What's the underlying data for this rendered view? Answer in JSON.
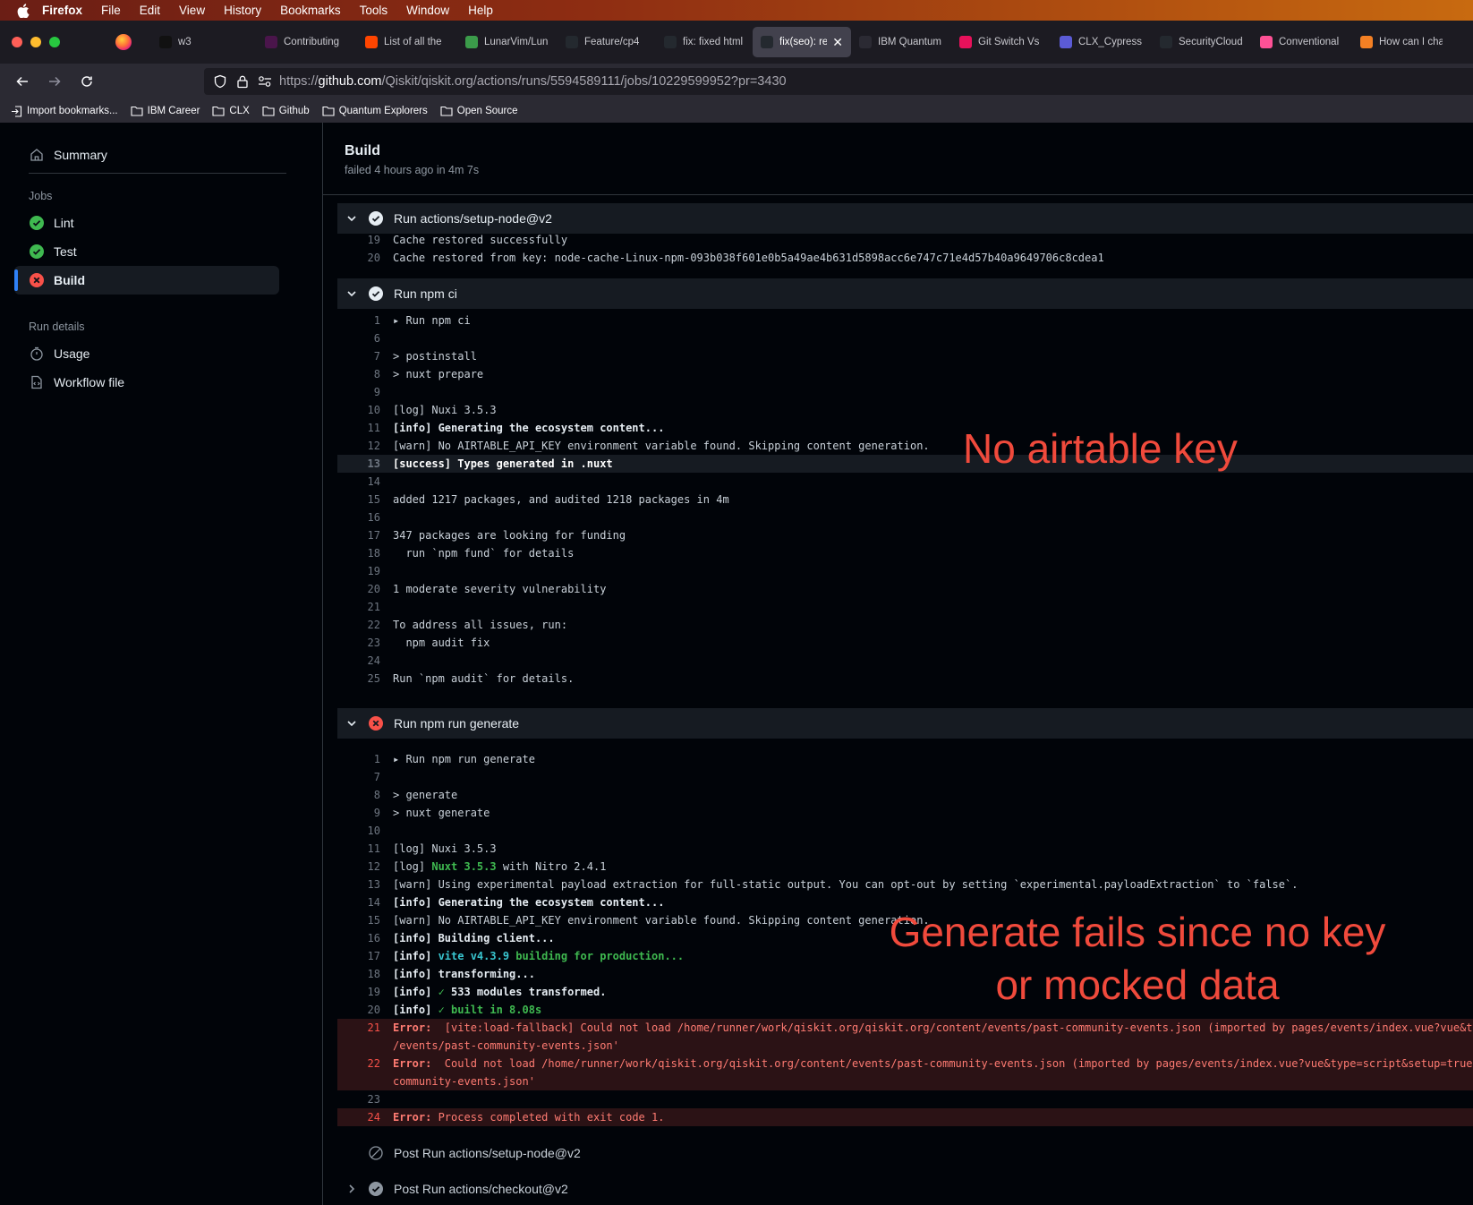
{
  "menubar": {
    "app": "Firefox",
    "items": [
      "File",
      "Edit",
      "View",
      "History",
      "Bookmarks",
      "Tools",
      "Window",
      "Help"
    ]
  },
  "tabs": [
    {
      "label": "w3",
      "icon": "w3-icon",
      "color": "#111111"
    },
    {
      "label": "Contributing",
      "icon": "slack-icon",
      "color": "#4a154b"
    },
    {
      "label": "List of all the",
      "icon": "reddit-icon",
      "color": "#ff4500"
    },
    {
      "label": "LunarVim/Lun",
      "icon": "neovim-icon",
      "color": "#3b9b4a"
    },
    {
      "label": "Feature/cp4",
      "icon": "github-icon",
      "color": "#24292f"
    },
    {
      "label": "fix: fixed html",
      "icon": "github-icon",
      "color": "#24292f"
    },
    {
      "label": "fix(seo): re",
      "icon": "github-fail-icon",
      "color": "#24292f",
      "active": true
    },
    {
      "label": "IBM Quantum",
      "icon": "ibm-quantum-icon",
      "color": "#2b2a33"
    },
    {
      "label": "Git Switch Vs",
      "icon": "git-icon",
      "color": "#e8115b"
    },
    {
      "label": "CLX_Cypress",
      "icon": "clx-icon",
      "color": "#5b5bd6"
    },
    {
      "label": "SecurityCloud",
      "icon": "github-icon",
      "color": "#24292f"
    },
    {
      "label": "Conventional",
      "icon": "conventional-icon",
      "color": "#fe5196"
    },
    {
      "label": "How can I cha",
      "icon": "stackoverflow-icon",
      "color": "#f48024"
    }
  ],
  "url": {
    "prefix": "https://",
    "host": "github.com",
    "path": "/Qiskit/qiskit.org/actions/runs/5594589111/jobs/10229599952?pr=3430"
  },
  "bookmarks": [
    "Import bookmarks...",
    "IBM Career",
    "CLX",
    "Github",
    "Quantum Explorers",
    "Open Source"
  ],
  "sidebar": {
    "summary": "Summary",
    "jobs_heading": "Jobs",
    "jobs": [
      {
        "label": "Lint",
        "status": "success"
      },
      {
        "label": "Test",
        "status": "success"
      },
      {
        "label": "Build",
        "status": "failure"
      }
    ],
    "run_details_heading": "Run details",
    "details": [
      {
        "label": "Usage"
      },
      {
        "label": "Workflow file"
      }
    ]
  },
  "job": {
    "title": "Build",
    "subtitle": "failed 4 hours ago in 4m 7s"
  },
  "steps": {
    "setup_node": {
      "title": "Run actions/setup-node@v2",
      "lines": [
        {
          "n": "19",
          "t": "Cache restored successfully"
        },
        {
          "n": "20",
          "t": "Cache restored from key: node-cache-Linux-npm-093b038f601e0b5a49ae4b631d5898acc6e747c71e4d57b40a9649706c8cdea1"
        }
      ]
    },
    "npm_ci": {
      "title": "Run npm ci",
      "lines": [
        {
          "n": "1",
          "t": "▸ Run npm ci"
        },
        {
          "n": "6",
          "t": ""
        },
        {
          "n": "7",
          "t": "> postinstall"
        },
        {
          "n": "8",
          "t": "> nuxt prepare"
        },
        {
          "n": "9",
          "t": ""
        },
        {
          "n": "10",
          "t": "[log] Nuxi 3.5.3"
        },
        {
          "n": "11",
          "t": "[info] Generating the ecosystem content..."
        },
        {
          "n": "12",
          "t": "[warn] No AIRTABLE_API_KEY environment variable found. Skipping content generation."
        },
        {
          "n": "13",
          "t": "[success] Types generated in .nuxt"
        },
        {
          "n": "14",
          "t": ""
        },
        {
          "n": "15",
          "t": "added 1217 packages, and audited 1218 packages in 4m"
        },
        {
          "n": "16",
          "t": ""
        },
        {
          "n": "17",
          "t": "347 packages are looking for funding"
        },
        {
          "n": "18",
          "t": "  run `npm fund` for details"
        },
        {
          "n": "19",
          "t": ""
        },
        {
          "n": "20",
          "t": "1 moderate severity vulnerability"
        },
        {
          "n": "21",
          "t": ""
        },
        {
          "n": "22",
          "t": "To address all issues, run:"
        },
        {
          "n": "23",
          "t": "  npm audit fix"
        },
        {
          "n": "24",
          "t": ""
        },
        {
          "n": "25",
          "t": "Run `npm audit` for details."
        }
      ]
    },
    "generate": {
      "title": "Run npm run generate",
      "lines": [
        {
          "n": "1",
          "t": "▸ Run npm run generate"
        },
        {
          "n": "7",
          "t": ""
        },
        {
          "n": "8",
          "t": "> generate"
        },
        {
          "n": "9",
          "t": "> nuxt generate"
        },
        {
          "n": "10",
          "t": ""
        },
        {
          "n": "11",
          "t": "[log] Nuxi 3.5.3"
        },
        {
          "n": "12a",
          "t": "[log] "
        },
        {
          "n": "12b",
          "t": "Nuxt 3.5.3"
        },
        {
          "n": "12c",
          "t": " with Nitro 2.4.1"
        },
        {
          "n": "13",
          "t": "[warn] Using experimental payload extraction for full-static output. You can opt-out by setting `experimental.payloadExtraction` to `false`."
        },
        {
          "n": "14",
          "t": "[info] Generating the ecosystem content..."
        },
        {
          "n": "15",
          "t": "[warn] No AIRTABLE_API_KEY environment variable found. Skipping content generation."
        },
        {
          "n": "16",
          "t": "[info] Building client..."
        },
        {
          "n": "17a",
          "t": "[info] "
        },
        {
          "n": "17b",
          "t": "vite v4.3.9"
        },
        {
          "n": "17c",
          "t": " building for production..."
        },
        {
          "n": "18",
          "t": "[info] transforming..."
        },
        {
          "n": "19a",
          "t": "[info] "
        },
        {
          "n": "19b",
          "t": "✓"
        },
        {
          "n": "19c",
          "t": " 533 modules transformed."
        },
        {
          "n": "20a",
          "t": "[info] "
        },
        {
          "n": "20b",
          "t": "✓ built in 8.08s"
        },
        {
          "n": "21a",
          "t": "Error:"
        },
        {
          "n": "21b",
          "t": "  [vite:load-fallback] Could not load /home/runner/work/qiskit.org/qiskit.org/content/events/past-community-events.json (imported by pages/events/index.vue?vue&t"
        },
        {
          "n": "21c",
          "t": "/events/past-community-events.json'"
        },
        {
          "n": "22a",
          "t": "Error:"
        },
        {
          "n": "22b",
          "t": "  Could not load /home/runner/work/qiskit.org/qiskit.org/content/events/past-community-events.json (imported by pages/events/index.vue?vue&type=script&setup=true"
        },
        {
          "n": "22c",
          "t": "community-events.json'"
        },
        {
          "n": "23",
          "t": ""
        },
        {
          "n": "24a",
          "t": "Error:"
        },
        {
          "n": "24b",
          "t": " Process completed with exit code 1."
        }
      ]
    },
    "post_setup_node": {
      "title": "Post Run actions/setup-node@v2"
    },
    "post_checkout": {
      "title": "Post Run actions/checkout@v2"
    }
  },
  "annotations": {
    "no_key": "No airtable key",
    "generate_fails_1": "Generate fails since no key",
    "generate_fails_2": "or mocked data"
  },
  "colors": {
    "success": "#3fb950",
    "failure": "#f85149",
    "accent": "#2f81f7",
    "annotation": "#f04a3c"
  }
}
